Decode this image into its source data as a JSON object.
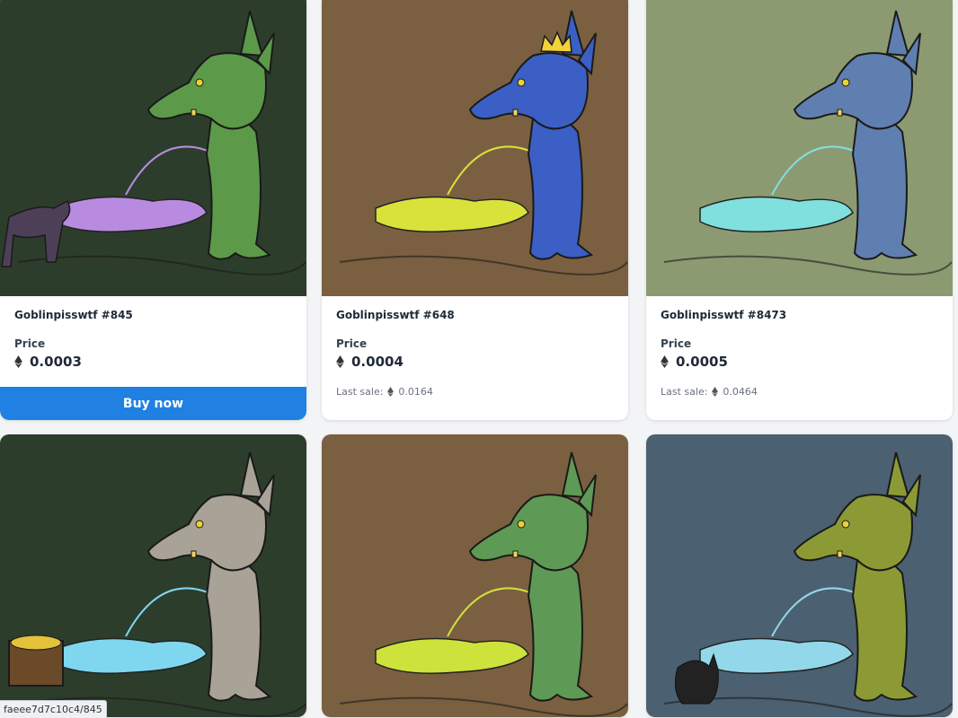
{
  "cards": [
    {
      "name": "Goblinpisswtf #845",
      "price_label": "Price",
      "price": "0.0003",
      "buy_label": "Buy now",
      "bg": "#2d3d2c",
      "goblin": "#5c9a4a",
      "puddle": "#b98be0",
      "extra": "dog"
    },
    {
      "name": "Goblinpisswtf #648",
      "price_label": "Price",
      "price": "0.0004",
      "last_sale_label": "Last sale:",
      "last_sale": "0.0164",
      "bg": "#7a6040",
      "goblin": "#3b5fc4",
      "puddle": "#d8e23a",
      "extra": "crown"
    },
    {
      "name": "Goblinpisswtf #8473",
      "price_label": "Price",
      "price": "0.0005",
      "last_sale_label": "Last sale:",
      "last_sale": "0.0464",
      "bg": "#8c9a72",
      "goblin": "#5f7fb0",
      "puddle": "#7fe0de",
      "extra": "none"
    },
    {
      "bg": "#2d3d2c",
      "goblin": "#a9a296",
      "puddle": "#7fd6ef",
      "extra": "chest"
    },
    {
      "bg": "#7a6040",
      "goblin": "#5e9a55",
      "puddle": "#cde23a",
      "extra": "none"
    },
    {
      "bg": "#4b6070",
      "goblin": "#8c9a36",
      "puddle": "#93d8ea",
      "extra": "cat"
    }
  ],
  "status_url": "faeee7d7c10c4/845",
  "colors": {
    "accent": "#2081e2"
  }
}
